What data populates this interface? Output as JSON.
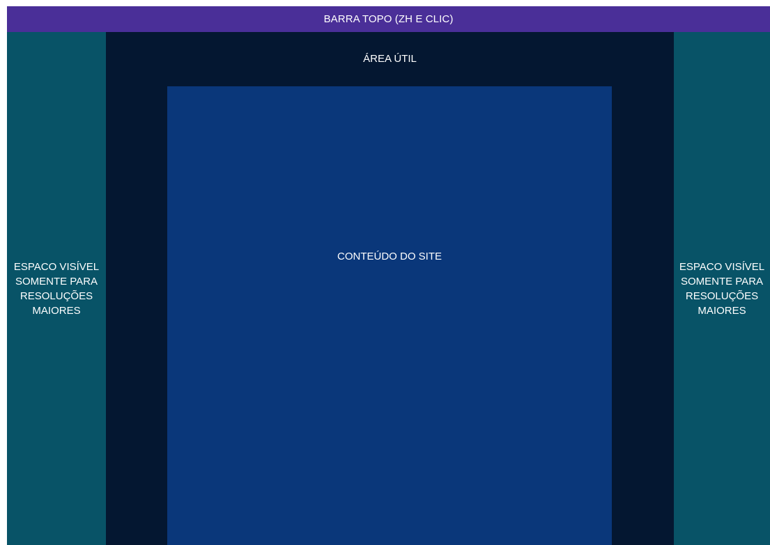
{
  "colors": {
    "topbar": "#4a2f98",
    "side_panels": "#085367",
    "useful_area": "#041731",
    "content": "#0a377a",
    "text": "#ffffff"
  },
  "topbar": {
    "label": "BARRA TOPO (ZH E CLIC)"
  },
  "useful_area": {
    "label": "ÁREA ÚTIL"
  },
  "content": {
    "label": "CONTEÚDO DO SITE"
  },
  "left_panel": {
    "lines": [
      "ESPACO VISÍVEL",
      "SOMENTE PARA",
      "RESOLUÇÕES",
      "MAIORES"
    ]
  },
  "right_panel": {
    "lines": [
      "ESPACO VISÍVEL",
      "SOMENTE PARA",
      "RESOLUÇÕES",
      "MAIORES"
    ]
  }
}
